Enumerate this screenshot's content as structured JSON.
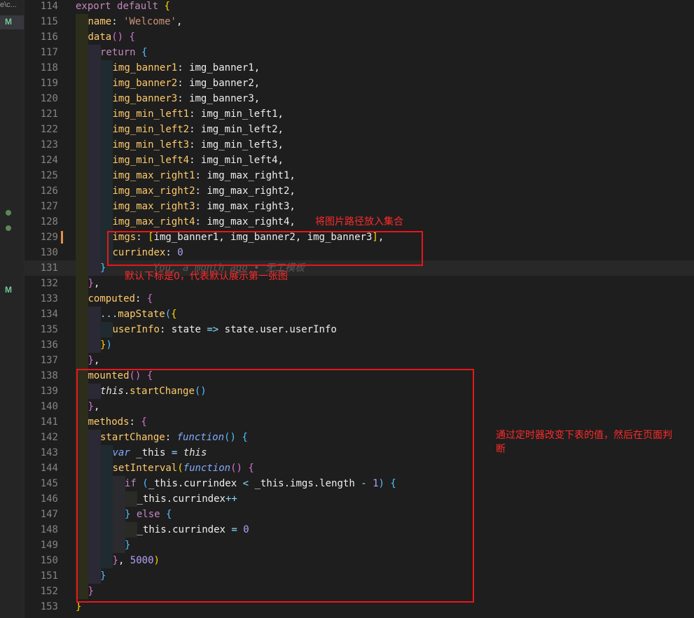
{
  "sidebar": {
    "path_fragment": "e\\c...",
    "git_badges": [
      "M",
      "M"
    ]
  },
  "annotations": {
    "note1": "将图片路径放入集合",
    "note2": "默认下标是0，代表默认展示第一张图",
    "note3": "通过定时器改变下表的值，然后在页面判断"
  },
  "colors": {
    "annotation_red": "#e8161b",
    "editor_bg": "#1e1e1e"
  },
  "lines": [
    {
      "n": "114",
      "indent": 0,
      "tokens": [
        [
          "kw",
          "export"
        ],
        [
          "plain",
          " "
        ],
        [
          "kw",
          "default"
        ],
        [
          "plain",
          " "
        ],
        [
          "p1",
          "{"
        ]
      ]
    },
    {
      "n": "115",
      "indent": 1,
      "tokens": [
        [
          "prop",
          "name"
        ],
        [
          "plain",
          ": "
        ],
        [
          "str",
          "'Welcome'"
        ],
        [
          "plain",
          ","
        ]
      ]
    },
    {
      "n": "116",
      "indent": 1,
      "tokens": [
        [
          "func",
          "data"
        ],
        [
          "p2",
          "()"
        ],
        [
          "plain",
          " "
        ],
        [
          "p2",
          "{"
        ]
      ]
    },
    {
      "n": "117",
      "indent": 2,
      "tokens": [
        [
          "kw",
          "return"
        ],
        [
          "plain",
          " "
        ],
        [
          "p3",
          "{"
        ]
      ]
    },
    {
      "n": "118",
      "indent": 3,
      "tokens": [
        [
          "prop",
          "img_banner1"
        ],
        [
          "plain",
          ": img_banner1,"
        ]
      ]
    },
    {
      "n": "119",
      "indent": 3,
      "tokens": [
        [
          "prop",
          "img_banner2"
        ],
        [
          "plain",
          ": img_banner2,"
        ]
      ]
    },
    {
      "n": "120",
      "indent": 3,
      "tokens": [
        [
          "prop",
          "img_banner3"
        ],
        [
          "plain",
          ": img_banner3,"
        ]
      ]
    },
    {
      "n": "121",
      "indent": 3,
      "tokens": [
        [
          "prop",
          "img_min_left1"
        ],
        [
          "plain",
          ": img_min_left1,"
        ]
      ]
    },
    {
      "n": "122",
      "indent": 3,
      "tokens": [
        [
          "prop",
          "img_min_left2"
        ],
        [
          "plain",
          ": img_min_left2,"
        ]
      ]
    },
    {
      "n": "123",
      "indent": 3,
      "tokens": [
        [
          "prop",
          "img_min_left3"
        ],
        [
          "plain",
          ": img_min_left3,"
        ]
      ]
    },
    {
      "n": "124",
      "indent": 3,
      "tokens": [
        [
          "prop",
          "img_min_left4"
        ],
        [
          "plain",
          ": img_min_left4,"
        ]
      ]
    },
    {
      "n": "125",
      "indent": 3,
      "tokens": [
        [
          "prop",
          "img_max_right1"
        ],
        [
          "plain",
          ": img_max_right1,"
        ]
      ]
    },
    {
      "n": "126",
      "indent": 3,
      "tokens": [
        [
          "prop",
          "img_max_right2"
        ],
        [
          "plain",
          ": img_max_right2,"
        ]
      ]
    },
    {
      "n": "127",
      "indent": 3,
      "tokens": [
        [
          "prop",
          "img_max_right3"
        ],
        [
          "plain",
          ": img_max_right3,"
        ]
      ]
    },
    {
      "n": "128",
      "indent": 3,
      "tokens": [
        [
          "prop",
          "img_max_right4"
        ],
        [
          "plain",
          ": img_max_right4,"
        ]
      ]
    },
    {
      "n": "129",
      "indent": 3,
      "modified": true,
      "tokens": [
        [
          "prop",
          "imgs"
        ],
        [
          "plain",
          ": "
        ],
        [
          "p1",
          "["
        ],
        [
          "plain",
          "img_banner1, img_banner2, img_banner3"
        ],
        [
          "p1",
          "]"
        ],
        [
          "plain",
          ","
        ]
      ]
    },
    {
      "n": "130",
      "indent": 3,
      "tokens": [
        [
          "prop",
          "currindex"
        ],
        [
          "plain",
          ": "
        ],
        [
          "num",
          "0"
        ]
      ]
    },
    {
      "n": "131",
      "indent": 2,
      "current": true,
      "tokens": [
        [
          "p3",
          "}"
        ],
        [
          "blame",
          "        You, a month ago • 无工模板"
        ]
      ]
    },
    {
      "n": "132",
      "indent": 1,
      "tokens": [
        [
          "p2",
          "}"
        ],
        [
          "plain",
          ","
        ]
      ]
    },
    {
      "n": "133",
      "indent": 1,
      "tokens": [
        [
          "prop",
          "computed"
        ],
        [
          "plain",
          ": "
        ],
        [
          "p2",
          "{"
        ]
      ]
    },
    {
      "n": "134",
      "indent": 2,
      "tokens": [
        [
          "op",
          "..."
        ],
        [
          "func",
          "mapState"
        ],
        [
          "p3",
          "("
        ],
        [
          "p1",
          "{"
        ]
      ]
    },
    {
      "n": "135",
      "indent": 3,
      "tokens": [
        [
          "prop",
          "userInfo"
        ],
        [
          "plain",
          ": state "
        ],
        [
          "op",
          "=>"
        ],
        [
          "plain",
          " state.user.userInfo"
        ]
      ]
    },
    {
      "n": "136",
      "indent": 2,
      "tokens": [
        [
          "p1",
          "}"
        ],
        [
          "p3",
          ")"
        ]
      ]
    },
    {
      "n": "137",
      "indent": 1,
      "tokens": [
        [
          "p2",
          "}"
        ],
        [
          "plain",
          ","
        ]
      ]
    },
    {
      "n": "138",
      "indent": 1,
      "tokens": [
        [
          "func",
          "mounted"
        ],
        [
          "p2",
          "()"
        ],
        [
          "plain",
          " "
        ],
        [
          "p2",
          "{"
        ]
      ]
    },
    {
      "n": "139",
      "indent": 2,
      "tokens": [
        [
          "this",
          "this"
        ],
        [
          "plain",
          "."
        ],
        [
          "func",
          "startChange"
        ],
        [
          "p3",
          "()"
        ]
      ]
    },
    {
      "n": "140",
      "indent": 1,
      "tokens": [
        [
          "p2",
          "}"
        ],
        [
          "plain",
          ","
        ]
      ]
    },
    {
      "n": "141",
      "indent": 1,
      "tokens": [
        [
          "prop",
          "methods"
        ],
        [
          "plain",
          ": "
        ],
        [
          "p2",
          "{"
        ]
      ]
    },
    {
      "n": "142",
      "indent": 2,
      "tokens": [
        [
          "func",
          "startChange"
        ],
        [
          "plain",
          ": "
        ],
        [
          "var",
          "function"
        ],
        [
          "p3",
          "()"
        ],
        [
          "plain",
          " "
        ],
        [
          "p3",
          "{"
        ]
      ]
    },
    {
      "n": "143",
      "indent": 3,
      "tokens": [
        [
          "var",
          "var"
        ],
        [
          "plain",
          " _this "
        ],
        [
          "op",
          "="
        ],
        [
          "plain",
          " "
        ],
        [
          "this",
          "this"
        ]
      ]
    },
    {
      "n": "144",
      "indent": 3,
      "tokens": [
        [
          "func",
          "setInterval"
        ],
        [
          "p1",
          "("
        ],
        [
          "var",
          "function"
        ],
        [
          "p2",
          "()"
        ],
        [
          "plain",
          " "
        ],
        [
          "p2",
          "{"
        ]
      ]
    },
    {
      "n": "145",
      "indent": 4,
      "tokens": [
        [
          "kw",
          "if"
        ],
        [
          "plain",
          " "
        ],
        [
          "p3",
          "("
        ],
        [
          "plain",
          "_this.currindex "
        ],
        [
          "op",
          "<"
        ],
        [
          "plain",
          " _this.imgs.length "
        ],
        [
          "op",
          "-"
        ],
        [
          "plain",
          " "
        ],
        [
          "num",
          "1"
        ],
        [
          "p3",
          ")"
        ],
        [
          "plain",
          " "
        ],
        [
          "p3",
          "{"
        ]
      ]
    },
    {
      "n": "146",
      "indent": 5,
      "tokens": [
        [
          "plain",
          "_this.currindex"
        ],
        [
          "op",
          "++"
        ]
      ]
    },
    {
      "n": "147",
      "indent": 4,
      "tokens": [
        [
          "p3",
          "}"
        ],
        [
          "plain",
          " "
        ],
        [
          "kw",
          "else"
        ],
        [
          "plain",
          " "
        ],
        [
          "p3",
          "{"
        ]
      ]
    },
    {
      "n": "148",
      "indent": 5,
      "tokens": [
        [
          "plain",
          "_this.currindex "
        ],
        [
          "op",
          "="
        ],
        [
          "plain",
          " "
        ],
        [
          "num",
          "0"
        ]
      ]
    },
    {
      "n": "149",
      "indent": 4,
      "tokens": [
        [
          "p3",
          "}"
        ]
      ]
    },
    {
      "n": "150",
      "indent": 3,
      "tokens": [
        [
          "p2",
          "}"
        ],
        [
          "plain",
          ", "
        ],
        [
          "num",
          "5000"
        ],
        [
          "p1",
          ")"
        ]
      ]
    },
    {
      "n": "151",
      "indent": 2,
      "tokens": [
        [
          "p3",
          "}"
        ]
      ]
    },
    {
      "n": "152",
      "indent": 1,
      "tokens": [
        [
          "p2",
          "}"
        ]
      ]
    },
    {
      "n": "153",
      "indent": 0,
      "tokens": [
        [
          "p1",
          "}"
        ]
      ]
    }
  ]
}
